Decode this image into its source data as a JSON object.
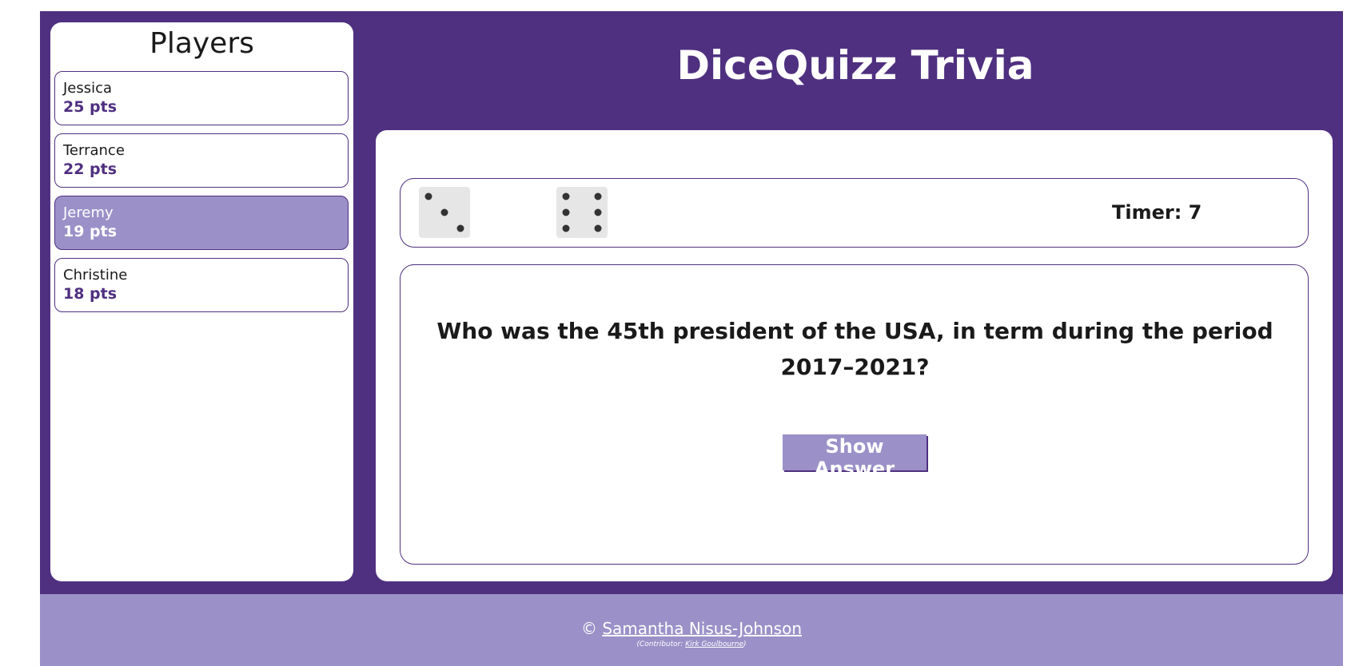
{
  "sidebar": {
    "title": "Players",
    "players": [
      {
        "name": "Jessica",
        "score": "25 pts",
        "active": false
      },
      {
        "name": "Terrance",
        "score": "22 pts",
        "active": false
      },
      {
        "name": "Jeremy",
        "score": "19 pts",
        "active": true
      },
      {
        "name": "Christine",
        "score": "18 pts",
        "active": false
      }
    ]
  },
  "header": {
    "title": "DiceQuizz Trivia"
  },
  "dice": {
    "values": [
      3,
      6
    ],
    "timer_label": "Timer: 7"
  },
  "question": {
    "text": "Who was the 45th president of the USA, in term during the period 2017–2021?",
    "show_answer_label": "Show Answer"
  },
  "footer": {
    "copyright_symbol": "©",
    "author": "Samantha Nisus-Johnson",
    "contributor_prefix": "(Contributor: ",
    "contributor": "Kirk Goulbourne",
    "contributor_suffix": ")"
  },
  "colors": {
    "primary": "#4f3080",
    "accent": "#9b91c8",
    "die_face": "#e6e6e6"
  }
}
